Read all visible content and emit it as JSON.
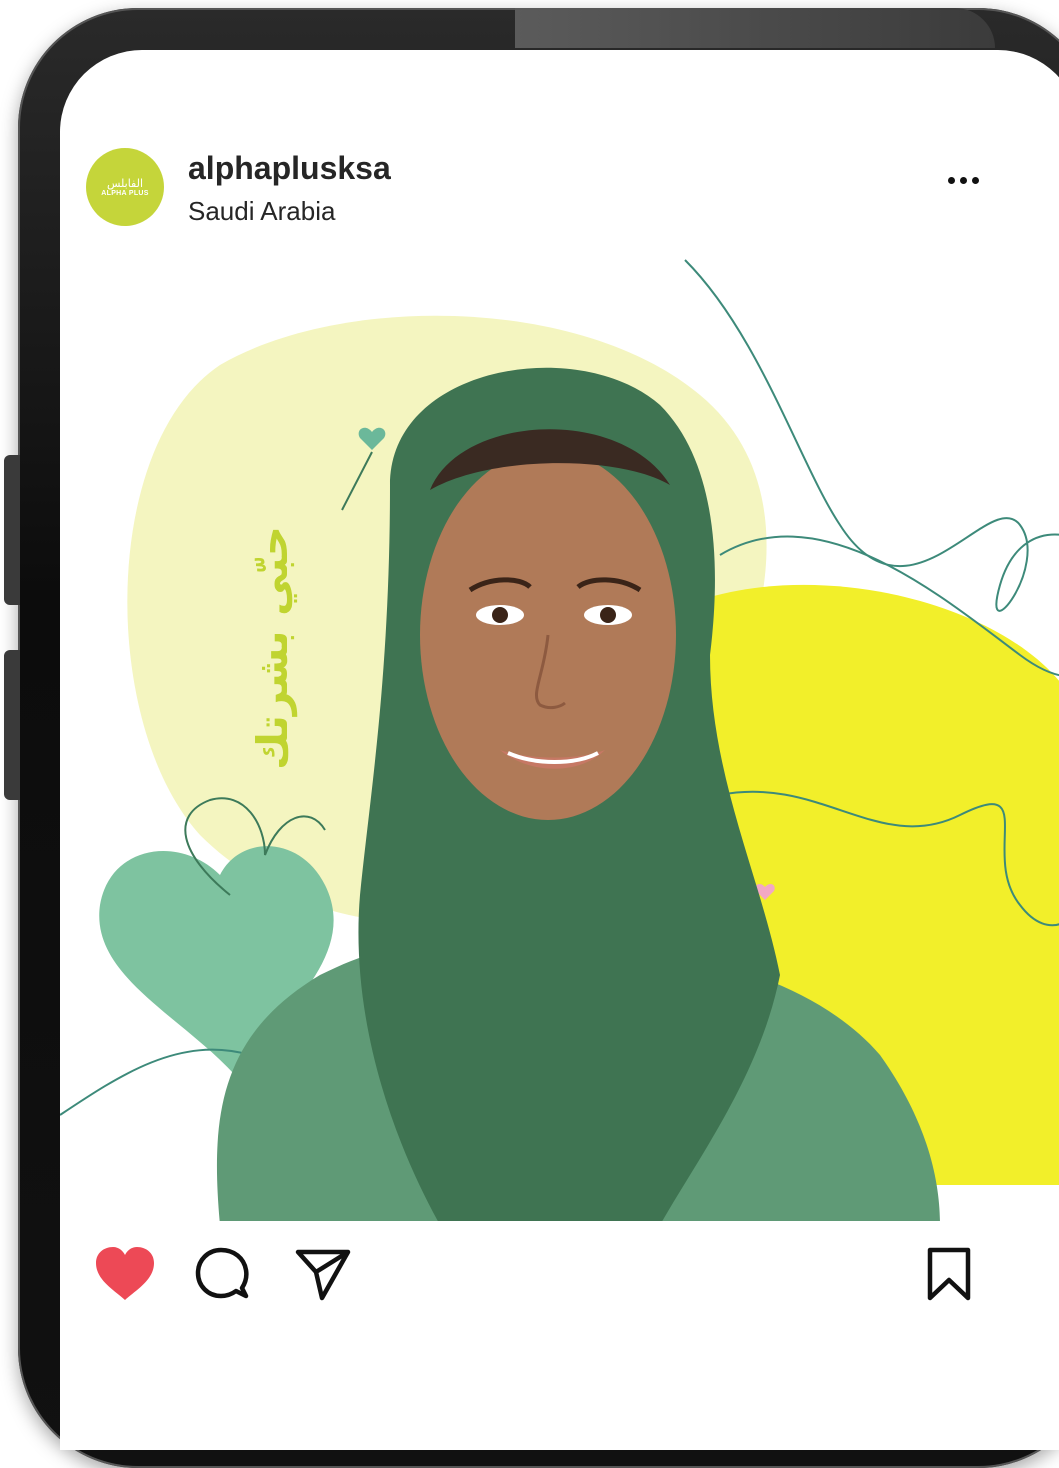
{
  "post": {
    "username": "alphaplusksa",
    "location": "Saudi Arabia",
    "avatar": {
      "arabic_text": "الفابلس",
      "english_text": "ALPHA PLUS"
    },
    "image_tagline": "حبّي بشرتك"
  },
  "icons": {
    "more": "more-options-icon",
    "like": "heart-filled-icon",
    "comment": "comment-icon",
    "share": "send-icon",
    "save": "bookmark-icon"
  },
  "colors": {
    "like_red": "#ed4956",
    "brand_lime": "#c5d53a",
    "hijab_green": "#3f7452",
    "yellow_blob": "#f2ef2a",
    "pale_blob": "#f4f5c0",
    "mint_heart": "#7ec3a0"
  }
}
